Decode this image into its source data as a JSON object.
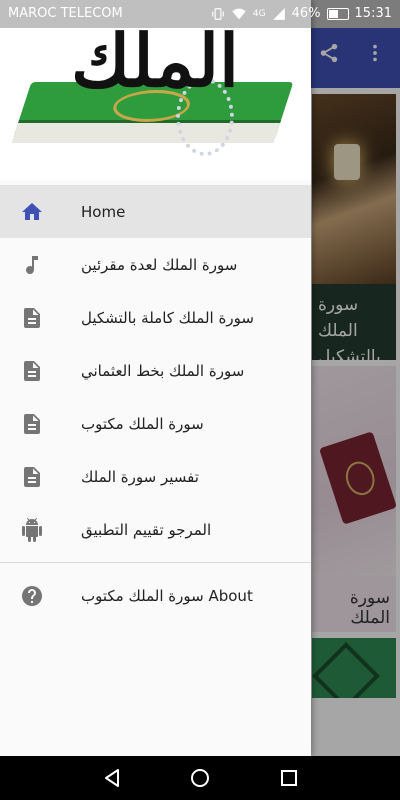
{
  "status_bar": {
    "carrier": "MAROC TELECOM",
    "network": "4G",
    "battery": "46%",
    "time": "15:31"
  },
  "drawer": {
    "header_calligraphy": "الملك",
    "items": [
      {
        "label": "Home",
        "icon": "home-icon",
        "active": true
      },
      {
        "label": "سورة الملك لعدة مقرئين",
        "icon": "music-note-icon"
      },
      {
        "label": "سورة الملك كاملة بالتشكيل",
        "icon": "document-icon"
      },
      {
        "label": "سورة الملك بخط العثماني",
        "icon": "document-icon"
      },
      {
        "label": "سورة الملك مكتوب",
        "icon": "document-icon"
      },
      {
        "label": "تفسير سورة الملك",
        "icon": "document-icon"
      },
      {
        "label": "المرجو تقييم التطبيق",
        "icon": "android-icon"
      }
    ],
    "about": {
      "label": "سورة الملك مكتوب About",
      "icon": "help-circle-icon"
    }
  },
  "background": {
    "card1_caption": "سورة الملك بالتشكيل",
    "card2_caption": "سورة الملك"
  },
  "colors": {
    "app_bar": "#3f51b5",
    "active_icon": "#3f51b5",
    "icon_gray": "#757575"
  }
}
